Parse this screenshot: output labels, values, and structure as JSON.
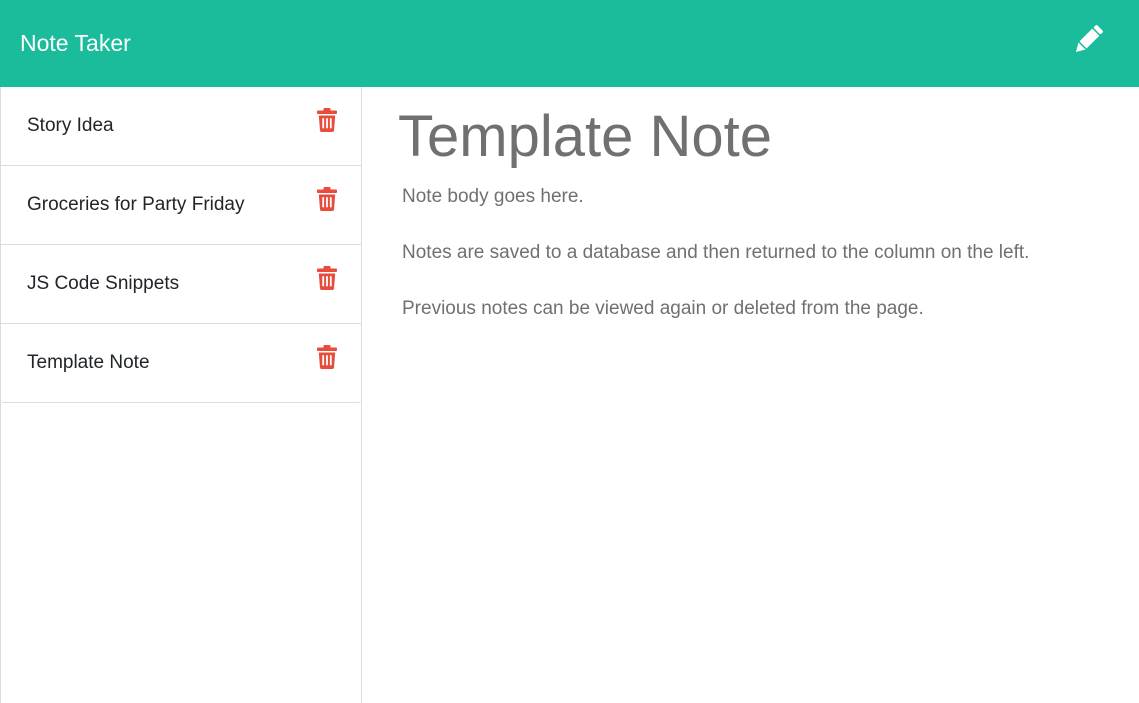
{
  "app": {
    "title": "Note Taker",
    "accent_color": "#1abc9c",
    "danger_color": "#e74c3c"
  },
  "toolbar": {
    "new_note_icon": "pencil-icon"
  },
  "sidebar": {
    "items": [
      {
        "label": "Story Idea",
        "delete_icon": "trash-icon"
      },
      {
        "label": "Groceries for Party Friday",
        "delete_icon": "trash-icon"
      },
      {
        "label": "JS Code Snippets",
        "delete_icon": "trash-icon"
      },
      {
        "label": "Template Note",
        "delete_icon": "trash-icon"
      }
    ]
  },
  "editor": {
    "title": "Template Note",
    "body": [
      "Note body goes here.",
      "Notes are saved to a database and then returned to the column on the left.",
      "Previous notes can be viewed again or deleted from the page."
    ]
  }
}
